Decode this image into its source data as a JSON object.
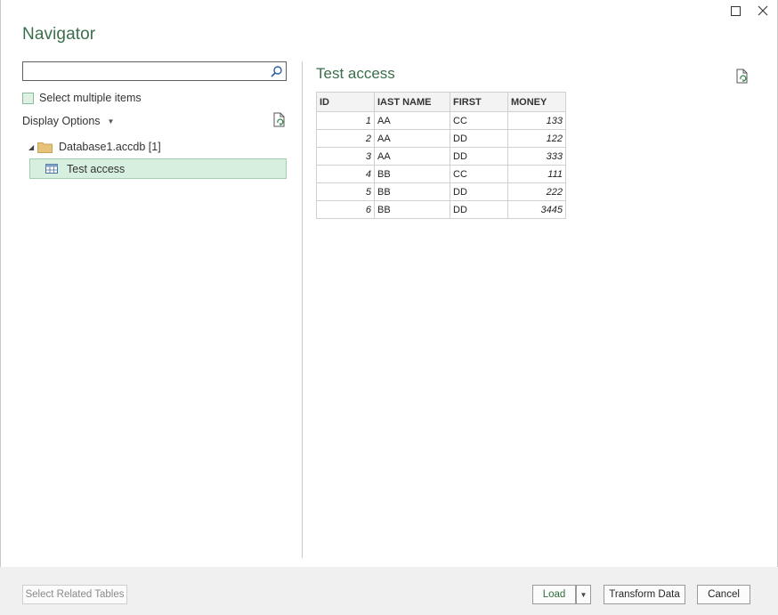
{
  "window": {
    "title": "Navigator",
    "controls": {
      "maximize_icon": "maximize-icon",
      "close_icon": "close-icon"
    }
  },
  "left_panel": {
    "search": {
      "value": "",
      "placeholder": "",
      "icon": "search-icon"
    },
    "select_multiple": {
      "label": "Select multiple items",
      "checked": false
    },
    "display_options": {
      "label": "Display Options",
      "icon": "caret-down-icon"
    },
    "refresh_icon": "refresh-icon",
    "tree": {
      "database": {
        "label": "Database1.accdb [1]",
        "expanded": true,
        "icon": "folder-icon"
      },
      "items": [
        {
          "label": "Test access",
          "selected": true,
          "icon": "table-icon"
        }
      ]
    }
  },
  "preview": {
    "title": "Test access",
    "refresh_icon": "refresh-icon",
    "columns": [
      "ID",
      "IAST NAME",
      "FIRST",
      "MONEY"
    ],
    "rows": [
      [
        "1",
        "AA",
        "CC",
        "133"
      ],
      [
        "2",
        "AA",
        "DD",
        "122"
      ],
      [
        "3",
        "AA",
        "DD",
        "333"
      ],
      [
        "4",
        "BB",
        "CC",
        "111"
      ],
      [
        "5",
        "BB",
        "DD",
        "222"
      ],
      [
        "6",
        "BB",
        "DD",
        "3445"
      ]
    ]
  },
  "footer": {
    "select_related": "Select Related Tables",
    "load": "Load",
    "load_dropdown_icon": "caret-down-icon",
    "transform": "Transform Data",
    "cancel": "Cancel"
  },
  "colors": {
    "accent": "#3b6e4b",
    "selection_bg": "#d7efdf",
    "selection_border": "#9fcfae",
    "footer_bg": "#f0f0f0"
  }
}
